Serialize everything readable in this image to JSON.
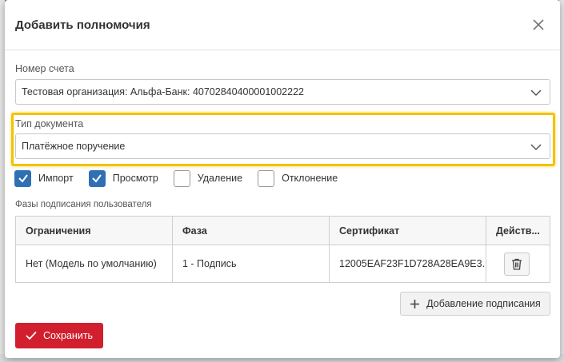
{
  "dialog": {
    "title": "Добавить полномочия"
  },
  "account": {
    "label": "Номер счета",
    "value": "Тестовая организация: Альфа-Банк: 40702840400001002222"
  },
  "document_type": {
    "label": "Тип документа",
    "value": "Платёжное поручение"
  },
  "permissions": [
    {
      "label": "Импорт",
      "checked": true
    },
    {
      "label": "Просмотр",
      "checked": true
    },
    {
      "label": "Удаление",
      "checked": false
    },
    {
      "label": "Отклонение",
      "checked": false
    }
  ],
  "phases": {
    "label": "Фазы подписания пользователя",
    "columns": [
      "Ограничения",
      "Фаза",
      "Сертификат",
      "Действ..."
    ],
    "rows": [
      {
        "restriction": "Нет (Модель по умолчанию)",
        "phase": "1 - Подпись",
        "certificate": "12005EAF23F1D728A28EA9E3..."
      }
    ]
  },
  "buttons": {
    "add_signature": "Добавление подписания",
    "save": "Сохранить"
  },
  "colors": {
    "accent": "#2f6fb3",
    "save": "#d21f2e",
    "highlight": "#f2c200"
  }
}
